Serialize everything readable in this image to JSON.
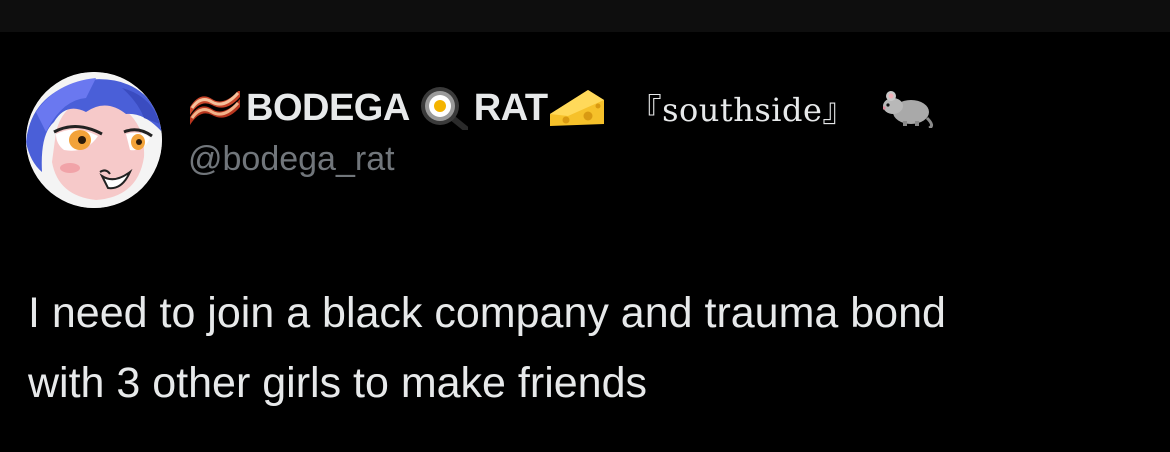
{
  "tweet": {
    "display_name_part1": "BODEGA",
    "display_name_part2": "RAT",
    "display_name_suffix": "『southside』",
    "handle": "@bodega_rat",
    "text": "I need to join a black company and trauma bond\nwith 3 other girls to make friends",
    "name_emojis": [
      "bacon-icon",
      "frying-pan-egg-icon",
      "cheese-icon",
      "rat-icon"
    ]
  },
  "colors": {
    "background": "#000000",
    "primary_text": "#e7e9ea",
    "secondary_text": "#71767b"
  }
}
